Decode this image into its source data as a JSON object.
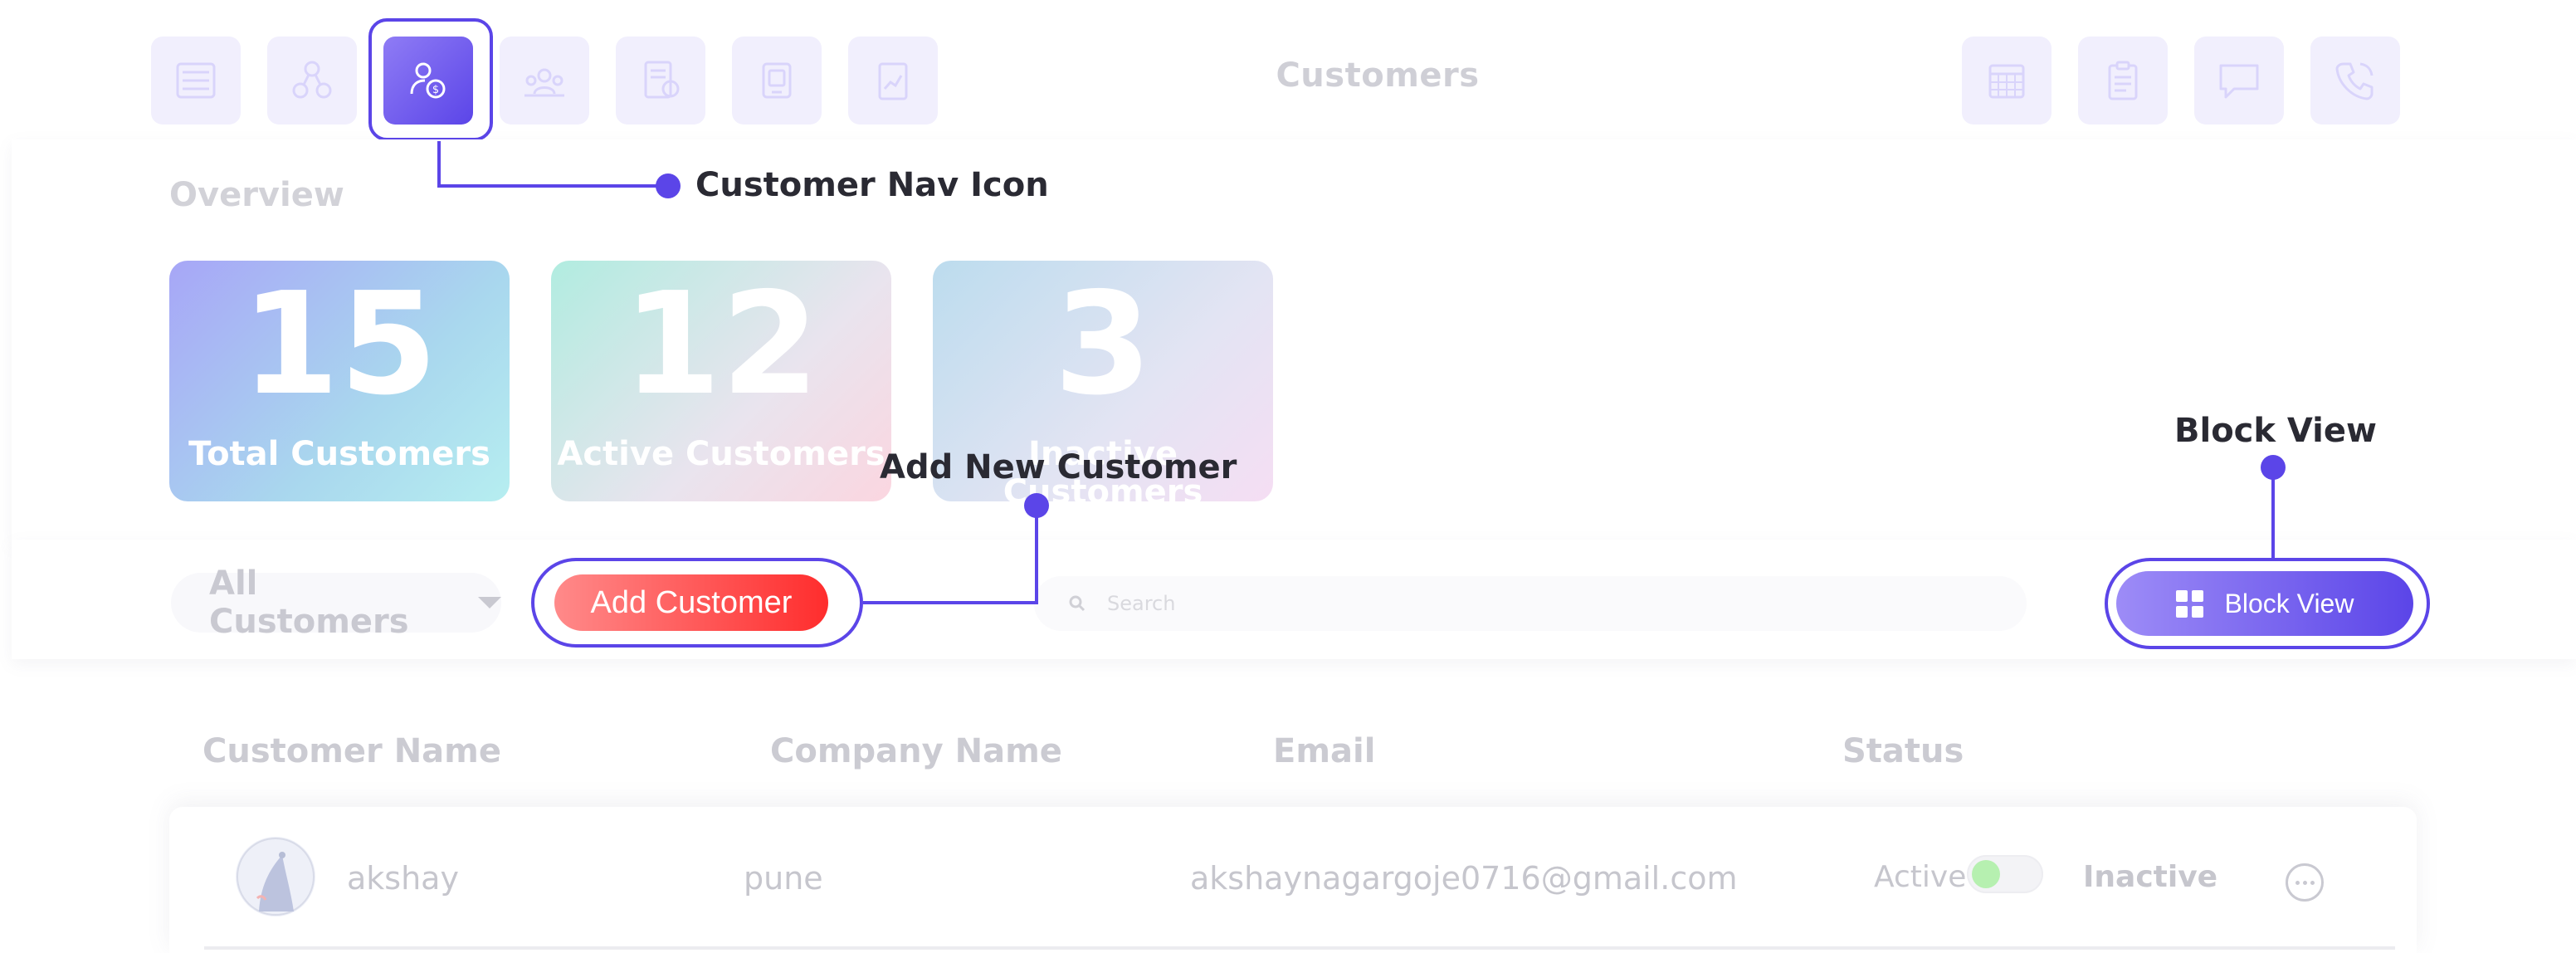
{
  "header": {
    "title": "Customers",
    "left_icons": [
      "list-icon",
      "network-icon",
      "customer-settings-icon",
      "team-icon",
      "invoice-icon",
      "device-icon",
      "report-icon"
    ],
    "right_icons": [
      "calendar-icon",
      "clipboard-icon",
      "chat-icon",
      "phone-icon"
    ],
    "active_icon": "customer-settings-icon"
  },
  "overview": {
    "label": "Overview",
    "cards": [
      {
        "value": "15",
        "label": "Total Customers"
      },
      {
        "value": "12",
        "label": "Active Customers"
      },
      {
        "value": "3",
        "label": "Inactive Customers"
      }
    ]
  },
  "toolbar": {
    "filter_label": "All Customers",
    "add_label": "Add Customer",
    "search_placeholder": "Search",
    "block_view_label": "Block View"
  },
  "table": {
    "headers": [
      "Customer Name",
      "Company Name",
      "Email",
      "Status"
    ],
    "rows": [
      {
        "name": "akshay",
        "company": "pune",
        "email": "akshaynagargoje0716@gmail.com",
        "status_active_label": "Active",
        "status_inactive_label": "Inactive",
        "is_active": true
      }
    ]
  },
  "annotations": {
    "nav_icon": "Customer Nav Icon",
    "add_new": "Add New Customer",
    "block_view": "Block View"
  },
  "colors": {
    "accent": "#5b45e8",
    "add_button": "#ff2d2d",
    "muted_text": "#c9c9d1"
  }
}
